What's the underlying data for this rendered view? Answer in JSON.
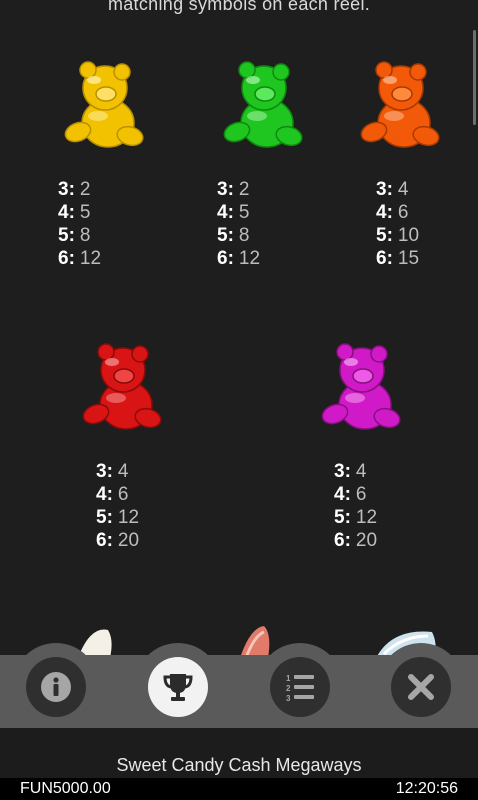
{
  "paytable": {
    "intro_text": "matching symbols on each reel.",
    "symbols": [
      {
        "name": "yellow-bear",
        "color": "#f2c200",
        "pays": [
          {
            "k": "3:",
            "v": "2"
          },
          {
            "k": "4:",
            "v": "5"
          },
          {
            "k": "5:",
            "v": "8"
          },
          {
            "k": "6:",
            "v": "12"
          }
        ]
      },
      {
        "name": "green-bear",
        "color": "#1fc61f",
        "pays": [
          {
            "k": "3:",
            "v": "2"
          },
          {
            "k": "4:",
            "v": "5"
          },
          {
            "k": "5:",
            "v": "8"
          },
          {
            "k": "6:",
            "v": "12"
          }
        ]
      },
      {
        "name": "orange-bear",
        "color": "#f25a0a",
        "pays": [
          {
            "k": "3:",
            "v": "4"
          },
          {
            "k": "4:",
            "v": "6"
          },
          {
            "k": "5:",
            "v": "10"
          },
          {
            "k": "6:",
            "v": "15"
          }
        ]
      },
      {
        "name": "red-bear",
        "color": "#d81414",
        "pays": [
          {
            "k": "3:",
            "v": "4"
          },
          {
            "k": "4:",
            "v": "6"
          },
          {
            "k": "5:",
            "v": "12"
          },
          {
            "k": "6:",
            "v": "20"
          }
        ]
      },
      {
        "name": "magenta-bear",
        "color": "#d01ac8",
        "pays": [
          {
            "k": "3:",
            "v": "4"
          },
          {
            "k": "4:",
            "v": "6"
          },
          {
            "k": "5:",
            "v": "12"
          },
          {
            "k": "6:",
            "v": "20"
          }
        ]
      }
    ]
  },
  "toolbar": {
    "buttons": [
      {
        "name": "info",
        "icon": "info-icon",
        "active": false
      },
      {
        "name": "paytable",
        "icon": "trophy-icon",
        "active": true
      },
      {
        "name": "rules",
        "icon": "numbered-list-icon",
        "active": false
      },
      {
        "name": "close",
        "icon": "close-icon",
        "active": false
      }
    ]
  },
  "game": {
    "title": "Sweet Candy Cash Megaways"
  },
  "status": {
    "balance": "FUN5000.00",
    "time": "12:20:56"
  }
}
